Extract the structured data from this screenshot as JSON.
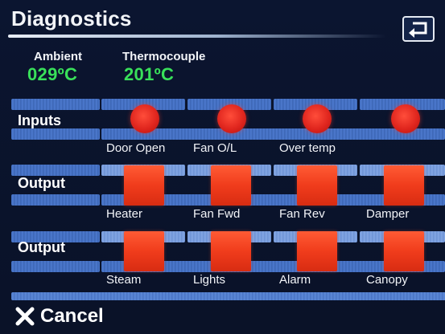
{
  "header": {
    "title": "Diagnostics",
    "back_icon": "return-arrow-icon"
  },
  "temps": {
    "ambient_label": "Ambient",
    "ambient_value": "029ºC",
    "thermocouple_label": "Thermocouple",
    "thermocouple_value": "201ºC",
    "value_color": "#39e05a"
  },
  "inputs": {
    "label": "Inputs",
    "items": [
      {
        "label": "Door Open"
      },
      {
        "label": "Fan O/L"
      },
      {
        "label": "Over temp"
      },
      {
        "label": ""
      }
    ],
    "indicator_color": "#e0261e"
  },
  "outputs_1": {
    "label": "Output",
    "items": [
      {
        "label": "Heater"
      },
      {
        "label": "Fan Fwd"
      },
      {
        "label": "Fan Rev"
      },
      {
        "label": "Damper"
      }
    ]
  },
  "outputs_2": {
    "label": "Output",
    "items": [
      {
        "label": "Steam"
      },
      {
        "label": "Lights"
      },
      {
        "label": "Alarm"
      },
      {
        "label": "Canopy"
      }
    ]
  },
  "footer": {
    "cancel_icon": "close-icon",
    "cancel_label": "Cancel"
  },
  "colors": {
    "background": "#0a1228",
    "band": "#4e7bd0",
    "output_button": "#f03c1c"
  }
}
